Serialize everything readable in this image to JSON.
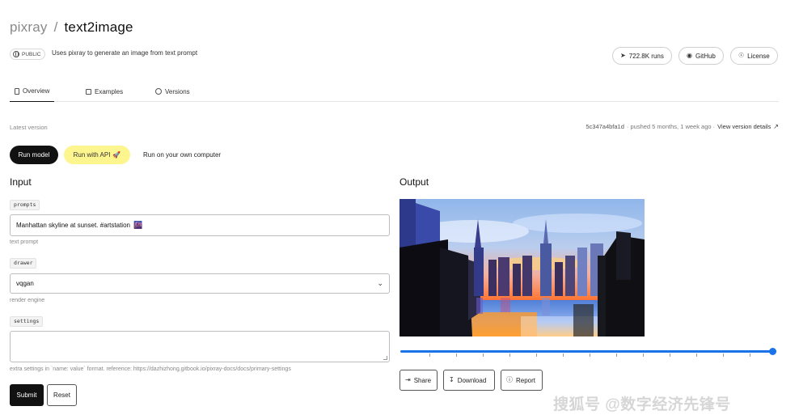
{
  "header": {
    "owner": "pixray",
    "separator": "/",
    "model_name": "text2image",
    "visibility_badge": "PUBLIC",
    "description": "Uses pixray to generate an image from text prompt",
    "runs_label": "722.8K runs",
    "github_label": "GitHub",
    "license_label": "License"
  },
  "tabs": [
    {
      "label": "Overview",
      "icon": "document-icon",
      "active": true
    },
    {
      "label": "Examples",
      "icon": "image-icon",
      "active": false
    },
    {
      "label": "Versions",
      "icon": "history-icon",
      "active": false
    }
  ],
  "version": {
    "label": "Latest version",
    "hash": "5c347a4bfa1d",
    "pushed": "· pushed 5 months, 1 week ago ·",
    "view_link": "View version details"
  },
  "run_tabs": {
    "run_model": "Run model",
    "run_api": "Run with API",
    "run_local": "Run on your own computer"
  },
  "input": {
    "heading": "Input",
    "prompts": {
      "tag": "prompts",
      "value": "Manhattan skyline at sunset. #artstation",
      "hint": "text prompt"
    },
    "drawer": {
      "tag": "drawer",
      "value": "vqgan",
      "hint": "render engine"
    },
    "settings": {
      "tag": "settings",
      "value": "",
      "hint": "extra settings in `name: value` format. reference: https://dazhizhong.gitbook.io/pixray-docs/docs/primary-settings"
    },
    "submit_label": "Submit",
    "reset_label": "Reset"
  },
  "output": {
    "heading": "Output",
    "timeline_position": 1.0,
    "share_label": "Share",
    "download_label": "Download",
    "report_label": "Report"
  },
  "watermark": "搜狐号 @数字经济先锋号",
  "colors": {
    "accent": "#1a73e8",
    "api_highlight": "#fdf58e",
    "primary_button": "#111111"
  }
}
